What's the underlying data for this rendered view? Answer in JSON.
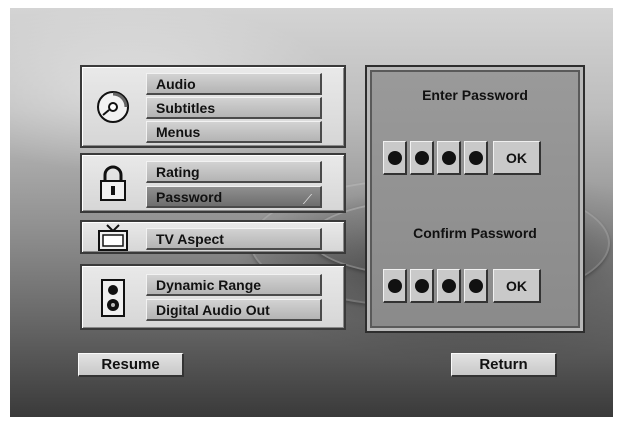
{
  "menu": {
    "groups": [
      {
        "icon": "disc-icon",
        "items": [
          {
            "label": "Audio"
          },
          {
            "label": "Subtitles"
          },
          {
            "label": "Menus"
          }
        ]
      },
      {
        "icon": "lock-icon",
        "items": [
          {
            "label": "Rating"
          },
          {
            "label": "Password"
          }
        ]
      },
      {
        "icon": "tv-icon",
        "items": [
          {
            "label": "TV Aspect"
          }
        ]
      },
      {
        "icon": "speaker-icon",
        "items": [
          {
            "label": "Dynamic Range"
          },
          {
            "label": "Digital Audio Out"
          }
        ]
      }
    ],
    "selected": "Password"
  },
  "password_panel": {
    "enter_label": "Enter Password",
    "confirm_label": "Confirm Password",
    "ok_label": "OK",
    "enter_digits_filled": 4,
    "confirm_digits_filled": 4
  },
  "buttons": {
    "resume_label": "Resume",
    "return_label": "Return"
  }
}
